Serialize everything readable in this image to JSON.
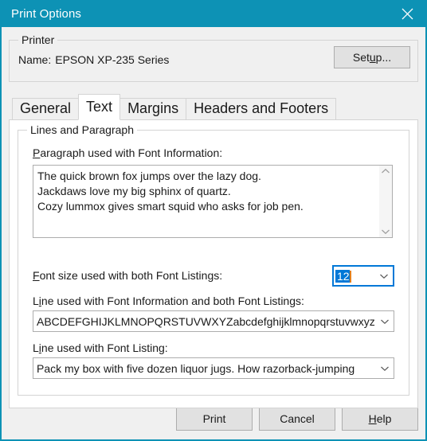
{
  "window": {
    "title": "Print Options",
    "close_icon": "close-icon",
    "accent_color": "#0d92b5",
    "background_color": "#f0f0f0"
  },
  "printer": {
    "group_title": "Printer",
    "name_label": "Name:",
    "name_value": "EPSON XP-235 Series",
    "setup_button": "Setup...",
    "setup_button_mnemonic": "u"
  },
  "tabs": [
    {
      "label": "General",
      "active": false
    },
    {
      "label": "Text",
      "active": true
    },
    {
      "label": "Margins",
      "active": false
    },
    {
      "label": "Headers and Footers",
      "active": false
    }
  ],
  "text_tab": {
    "group_title": "Lines and Paragraph",
    "paragraph": {
      "label_mnemonic": "P",
      "label_rest": "aragraph used with Font Information:",
      "lines": [
        "The quick brown fox jumps over the lazy dog.",
        "Jackdaws love my big sphinx of quartz.",
        "Cozy lummox gives smart squid who asks for job pen."
      ],
      "scroll_up_icon": "chevron-up-icon",
      "scroll_down_icon": "chevron-down-icon"
    },
    "font_size": {
      "label_mnemonic": "F",
      "label_rest": "ont size used with both Font Listings:",
      "value": "12",
      "selected": true,
      "focus_color": "#0078d7",
      "selection_color": "#0078d7",
      "caret_color": "#e08020",
      "arrow_icon": "chevron-down-icon"
    },
    "line_with_info": {
      "label_prefix": "L",
      "label_mnemonic": "i",
      "label_rest": "ne used with Font Information and both Font Listings:",
      "value": "ABCDEFGHIJKLMNOPQRSTUVWXYZabcdefghijklmnopqrstuvwxyz",
      "arrow_icon": "chevron-down-icon"
    },
    "line_with_listing": {
      "label_prefix": "L",
      "label_mnemonic": "i",
      "label_rest": "ne used with Font Listing:",
      "value": "Pack my box with five dozen liquor jugs. How razorback-jumping",
      "arrow_icon": "chevron-down-icon"
    }
  },
  "footer": {
    "print_button": "Print",
    "cancel_button": "Cancel",
    "help_button_mnemonic": "H",
    "help_button_rest": "elp"
  }
}
